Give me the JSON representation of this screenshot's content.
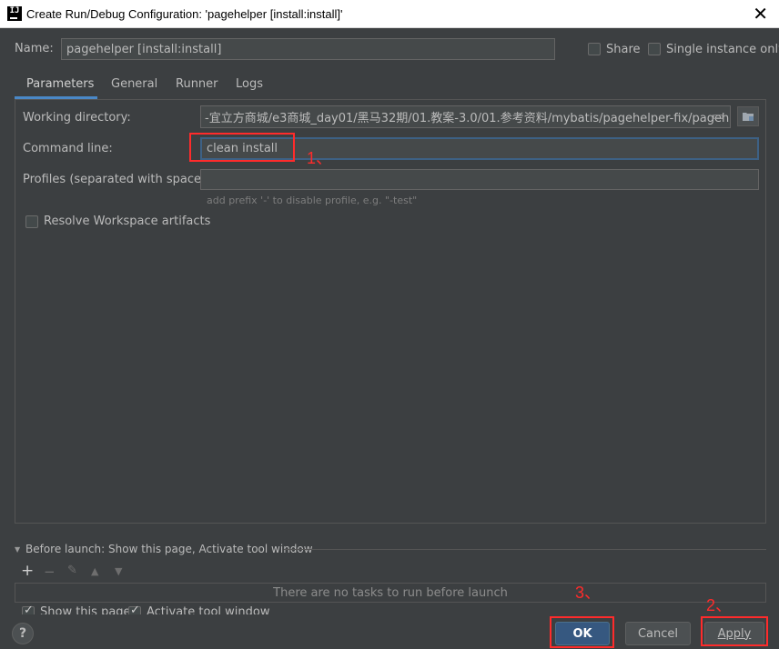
{
  "window": {
    "title": "Create Run/Debug Configuration: 'pagehelper [install:install]'",
    "close": "✕"
  },
  "name_row": {
    "name_label": "Name:",
    "name_value": "pagehelper [install:install]",
    "share_label": "Share",
    "share_checked": false,
    "single_instance_label": "Single instance only",
    "single_instance_checked": false
  },
  "tabs": [
    {
      "label": "Parameters",
      "active": true
    },
    {
      "label": "General",
      "active": false
    },
    {
      "label": "Runner",
      "active": false
    },
    {
      "label": "Logs",
      "active": false
    }
  ],
  "parameters": {
    "working_dir_label": "Working directory:",
    "working_dir_value": "-宜立方商城/e3商城_day01/黑马32期/01.教案-3.0/01.参考资料/mybatis/pagehelper-fix/pagehelper",
    "command_line_label": "Command line:",
    "command_line_value": "clean install",
    "profiles_label": "Profiles (separated with space):",
    "profiles_value": "",
    "profiles_hint": "add prefix '-' to disable profile, e.g. \"-test\"",
    "resolve_label": "Resolve Workspace artifacts",
    "resolve_checked": false
  },
  "before_launch": {
    "header": "Before launch: Show this page, Activate tool window",
    "empty_text": "There are no tasks to run before launch",
    "show_page_label": "Show this page",
    "show_page_checked": true,
    "activate_label": "Activate tool window",
    "activate_checked": true
  },
  "buttons": {
    "ok": "OK",
    "cancel": "Cancel",
    "apply": "Apply",
    "help": "?"
  },
  "annotations": {
    "one": "1、",
    "two": "2、",
    "three": "3、"
  },
  "colors": {
    "background": "#3c3f41",
    "accent": "#4a88c7",
    "annotation": "#ff2b2b",
    "primary_button": "#365880"
  }
}
